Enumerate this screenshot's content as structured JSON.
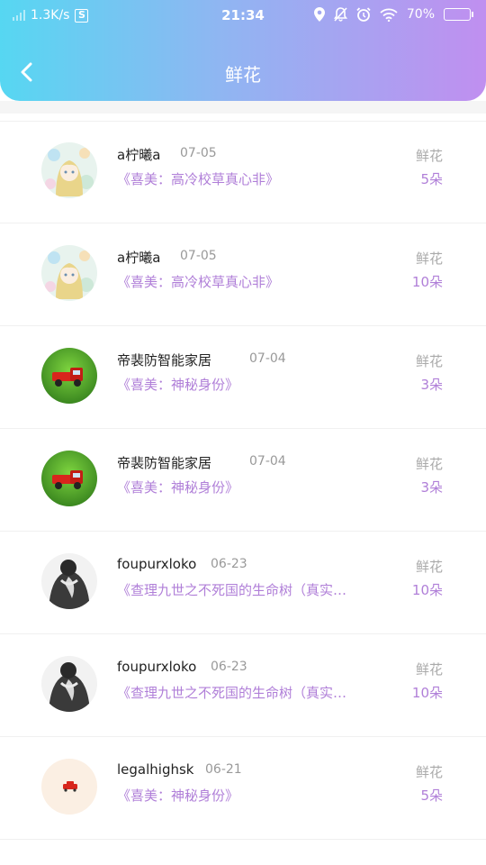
{
  "status_bar": {
    "network_speed": "1.3K/s",
    "sim_badge": "S",
    "time": "21:34",
    "battery": "70%",
    "battery_level": 0.7
  },
  "nav": {
    "back_icon": "chevron-left-icon",
    "title": "鲜花"
  },
  "colors": {
    "gradient_start": "#56d7f2",
    "gradient_end": "#c08ff0",
    "accent_purple": "#b07fd8"
  },
  "records": [
    {
      "user": "a柠曦a",
      "date": "07-05",
      "title": "《喜美：高冷校草真心非》",
      "label": "鲜花",
      "count": "5朵",
      "avatar": "anime-girl-avatar"
    },
    {
      "user": "a柠曦a",
      "date": "07-05",
      "title": "《喜美：高冷校草真心非》",
      "label": "鲜花",
      "count": "10朵",
      "avatar": "anime-girl-avatar"
    },
    {
      "user": "帝裴防智能家居",
      "date": "07-04",
      "title": "《喜美：神秘身份》",
      "label": "鲜花",
      "count": "3朵",
      "avatar": "red-truck-avatar"
    },
    {
      "user": "帝裴防智能家居",
      "date": "07-04",
      "title": "《喜美：神秘身份》",
      "label": "鲜花",
      "count": "3朵",
      "avatar": "red-truck-avatar"
    },
    {
      "user": "foupurxloko",
      "date": "06-23",
      "title": "《查理九世之不死国的生命树（真实…",
      "label": "鲜花",
      "count": "10朵",
      "avatar": "monochrome-figure-avatar"
    },
    {
      "user": "foupurxloko",
      "date": "06-23",
      "title": "《查理九世之不死国的生命树（真实…",
      "label": "鲜花",
      "count": "10朵",
      "avatar": "monochrome-figure-avatar"
    },
    {
      "user": "legalhighsk",
      "date": "06-21",
      "title": "《喜美：神秘身份》",
      "label": "鲜花",
      "count": "5朵",
      "avatar": "small-car-avatar"
    }
  ]
}
